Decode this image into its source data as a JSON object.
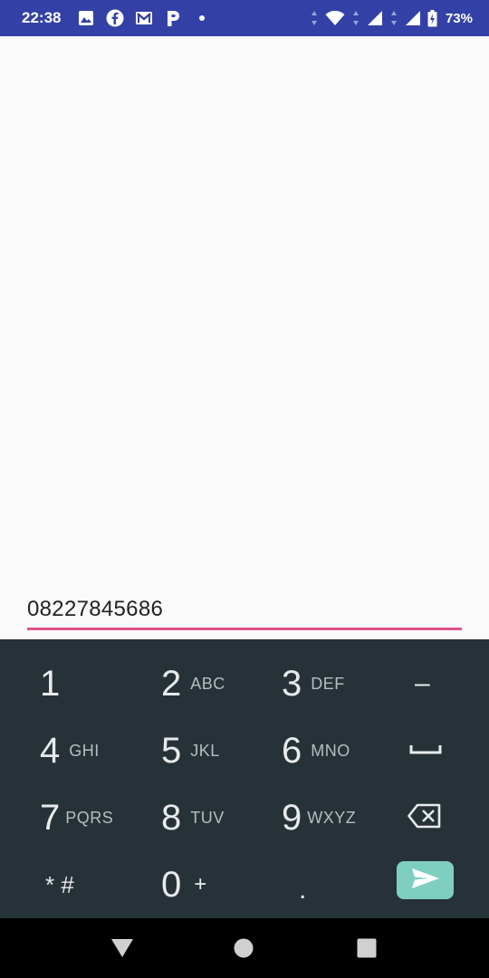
{
  "status_bar": {
    "time": "22:38",
    "battery": "73%",
    "left_icons": [
      "image-icon",
      "facebook-icon",
      "gmail-icon",
      "p-app-icon",
      "dot-icon"
    ],
    "right_icons": [
      "data-arrows-icon",
      "wifi-icon",
      "signal-icon",
      "signal-icon",
      "battery-charging-icon"
    ]
  },
  "input": {
    "value": "08227845686",
    "underline_color": "#e05189"
  },
  "keypad": {
    "keys": [
      {
        "digit": "1",
        "letters": ""
      },
      {
        "digit": "2",
        "letters": "ABC"
      },
      {
        "digit": "3",
        "letters": "DEF"
      },
      {
        "digit": "4",
        "letters": "GHI"
      },
      {
        "digit": "5",
        "letters": "JKL"
      },
      {
        "digit": "6",
        "letters": "MNO"
      },
      {
        "digit": "7",
        "letters": "PQRS"
      },
      {
        "digit": "8",
        "letters": "TUV"
      },
      {
        "digit": "9",
        "letters": "WXYZ"
      },
      {
        "digit": "0",
        "letters": "+"
      }
    ],
    "star_hash": "* #",
    "period": ".",
    "dash": "–",
    "space_icon": "space-icon",
    "backspace_icon": "backspace-icon",
    "send_icon": "send-icon",
    "background": "#263238",
    "send_color": "#7fcfc1"
  },
  "nav": {
    "back": "back-icon",
    "home": "home-icon",
    "recents": "recents-icon"
  }
}
